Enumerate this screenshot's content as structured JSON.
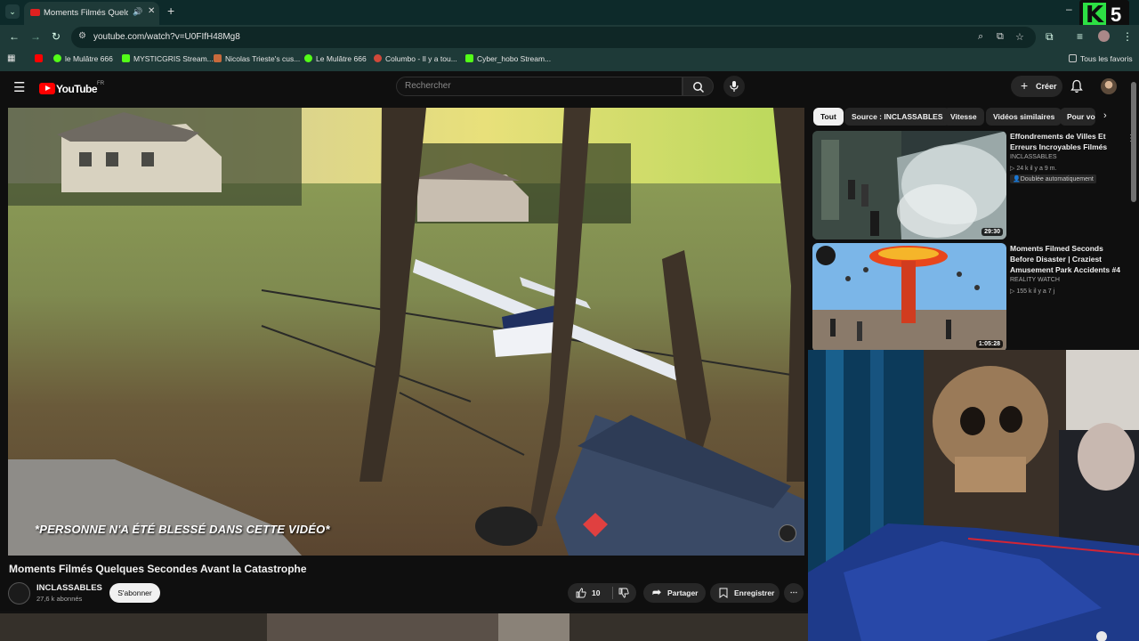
{
  "browser": {
    "tab": {
      "title": "Moments Filmés Quelques Secondes Avant la Catastrophe",
      "audio_icon": "speaker-icon"
    },
    "url": "youtube.com/watch?v=U0FIfH48Mg8",
    "bookmarks": [
      {
        "label": "",
        "color": "#ff0000"
      },
      {
        "label": "le Mulâtre 666",
        "color": "#53fc18"
      },
      {
        "label": "MYSTICGRIS Stream...",
        "color": "#53fc18"
      },
      {
        "label": "Nicolas Trieste's cus...",
        "color": "#c86a3c"
      },
      {
        "label": "Le Mulâtre 666",
        "color": "#53fc18"
      },
      {
        "label": "Columbo - Il y a tou...",
        "color": "#d0493a"
      },
      {
        "label": "Cyber_hobo Stream...",
        "color": "#53fc18"
      }
    ],
    "all_bookmarks": "Tous les favoris"
  },
  "overlay": {
    "kick_letter": "K",
    "kick_number": "5"
  },
  "youtube": {
    "logo": "YouTube",
    "logo_country": "FR",
    "search_placeholder": "Rechercher",
    "create_label": "Créer"
  },
  "video": {
    "caption": "*PERSONNE N'A ÉTÉ BLESSÉ DANS CETTE VIDÉO*",
    "title": "Moments Filmés Quelques Secondes Avant la Catastrophe",
    "channel": "INCLASSABLES",
    "subscribers": "27,6 k abonnés",
    "subscribe_label": "S'abonner",
    "likes": "10",
    "share_label": "Partager",
    "save_label": "Enregistrer"
  },
  "chips": [
    "Tout",
    "Source : INCLASSABLES",
    "Vitesse",
    "Vidéos similaires",
    "Pour vous"
  ],
  "recommendations": [
    {
      "title": "Effondrements de Villes Et Erreurs Incroyables Filmés",
      "channel": "INCLASSABLES",
      "meta": "24 k  il y a 9 m.",
      "badge": "Doublée automatiquement",
      "duration": "29:30"
    },
    {
      "title": "Moments Filmed Seconds Before Disaster | Craziest Amusement Park Accidents #4",
      "channel": "REALITY WATCH",
      "meta": "155 k  il y a 7 j",
      "duration": "1:05:28"
    }
  ],
  "colors": {
    "yt_red": "#ff0000",
    "browser_bg": "#1e3a38",
    "kick_green": "#53fc18"
  }
}
